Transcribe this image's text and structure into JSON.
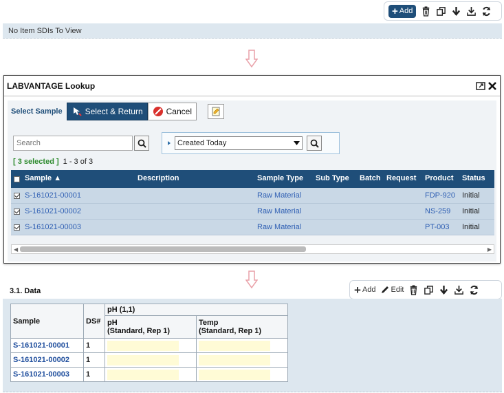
{
  "top_toolbar": {
    "add_label": "Add"
  },
  "top_empty": {
    "text": "No Item SDIs To View"
  },
  "dialog": {
    "title": "LABVANTAGE Lookup",
    "select_label": "Select Sample",
    "select_return_label": "Select & Return",
    "cancel_label": "Cancel",
    "search_placeholder": "Search",
    "filter_value": "Created Today",
    "selected_count": "[ 3 selected ]",
    "range": "1 - 3 of 3",
    "columns": [
      "Sample",
      "Description",
      "Sample Type",
      "Sub Type",
      "Batch",
      "Request",
      "Product",
      "Status"
    ],
    "rows": [
      {
        "sample": "S-161021-00001",
        "type": "Raw Material",
        "product": "FDP-920",
        "status": "Initial"
      },
      {
        "sample": "S-161021-00002",
        "type": "Raw Material",
        "product": "NS-259",
        "status": "Initial"
      },
      {
        "sample": "S-161021-00003",
        "type": "Raw Material",
        "product": "PT-003",
        "status": "Initial"
      }
    ]
  },
  "data_section": {
    "title": "3.1.  Data",
    "add_label": "Add",
    "edit_label": "Edit",
    "header_sample": "Sample",
    "header_ds": "DS#",
    "header_group": "pH (1,1)",
    "header_ph": "pH",
    "header_ph_sub": "(Standard, Rep 1)",
    "header_temp": "Temp",
    "header_temp_sub": "(Standard, Rep 1)",
    "rows": [
      {
        "sample": "S-161021-00001",
        "ds": "1"
      },
      {
        "sample": "S-161021-00002",
        "ds": "1"
      },
      {
        "sample": "S-161021-00003",
        "ds": "1"
      }
    ]
  },
  "colors": {
    "primary": "#1f4e79",
    "link": "#2f5fb3",
    "row_selected": "#c9d8e6",
    "panel": "#dde7ef",
    "arrow": "#e9a0a8"
  }
}
